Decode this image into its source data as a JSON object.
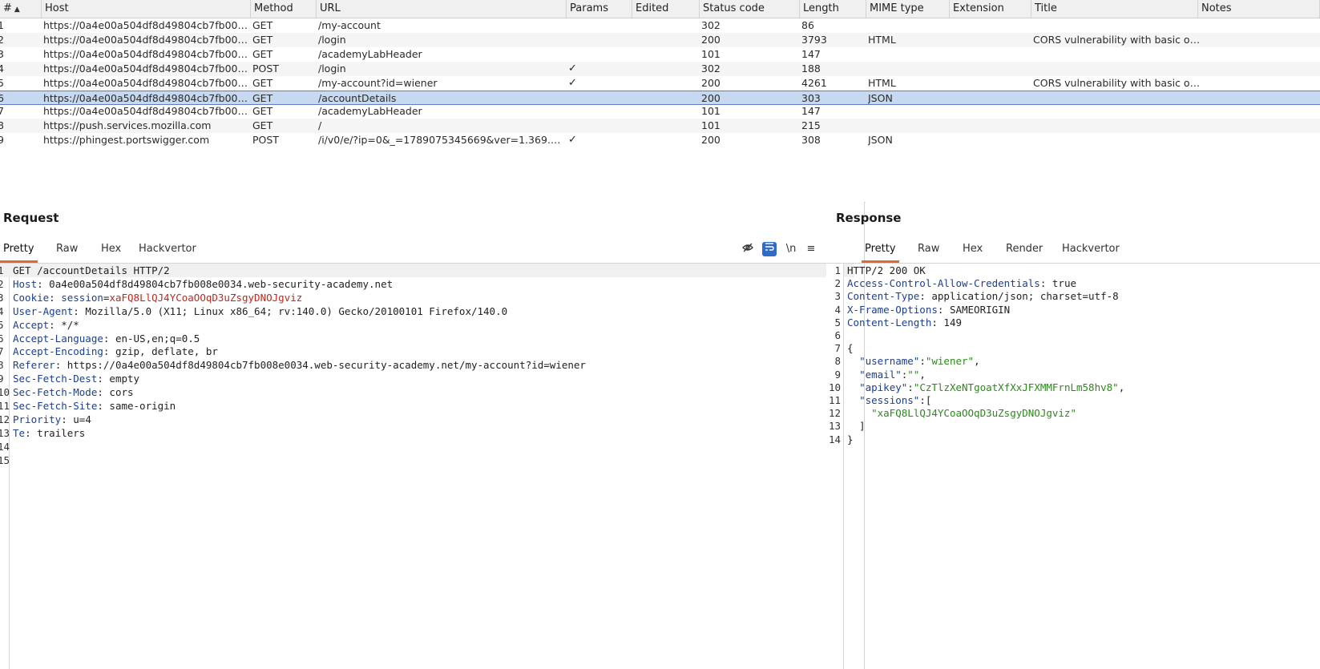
{
  "history": {
    "columns": [
      "#",
      "Host",
      "Method",
      "URL",
      "Params",
      "Edited",
      "Status code",
      "Length",
      "MIME type",
      "Extension",
      "Title",
      "Notes"
    ],
    "rows": [
      {
        "num": "1",
        "host": "https://0a4e00a504df8d49804cb7fb008e0...",
        "method": "GET",
        "url": "/my-account",
        "params": "",
        "edited": "",
        "status": "302",
        "length": "86",
        "mime": "",
        "ext": "",
        "title": ""
      },
      {
        "num": "2",
        "host": "https://0a4e00a504df8d49804cb7fb008e0...",
        "method": "GET",
        "url": "/login",
        "params": "",
        "edited": "",
        "status": "200",
        "length": "3793",
        "mime": "HTML",
        "ext": "",
        "title": "CORS vulnerability with basic origin..."
      },
      {
        "num": "3",
        "host": "https://0a4e00a504df8d49804cb7fb008e0...",
        "method": "GET",
        "url": "/academyLabHeader",
        "params": "",
        "edited": "",
        "status": "101",
        "length": "147",
        "mime": "",
        "ext": "",
        "title": ""
      },
      {
        "num": "4",
        "host": "https://0a4e00a504df8d49804cb7fb008e0...",
        "method": "POST",
        "url": "/login",
        "params": "✓",
        "edited": "",
        "status": "302",
        "length": "188",
        "mime": "",
        "ext": "",
        "title": ""
      },
      {
        "num": "5",
        "host": "https://0a4e00a504df8d49804cb7fb008e0...",
        "method": "GET",
        "url": "/my-account?id=wiener",
        "params": "✓",
        "edited": "",
        "status": "200",
        "length": "4261",
        "mime": "HTML",
        "ext": "",
        "title": "CORS vulnerability with basic origin..."
      },
      {
        "num": "6",
        "host": "https://0a4e00a504df8d49804cb7fb008e0...",
        "method": "GET",
        "url": "/accountDetails",
        "params": "",
        "edited": "",
        "status": "200",
        "length": "303",
        "mime": "JSON",
        "ext": "",
        "title": ""
      },
      {
        "num": "7",
        "host": "https://0a4e00a504df8d49804cb7fb008e0...",
        "method": "GET",
        "url": "/academyLabHeader",
        "params": "",
        "edited": "",
        "status": "101",
        "length": "147",
        "mime": "",
        "ext": "",
        "title": ""
      },
      {
        "num": "8",
        "host": "https://push.services.mozilla.com",
        "method": "GET",
        "url": "/",
        "params": "",
        "edited": "",
        "status": "101",
        "length": "215",
        "mime": "",
        "ext": "",
        "title": ""
      },
      {
        "num": "9",
        "host": "https://phingest.portswigger.com",
        "method": "POST",
        "url": "/i/v0/e/?ip=0&_=1789075345669&ver=1.369.0&comp...",
        "params": "✓",
        "edited": "",
        "status": "200",
        "length": "308",
        "mime": "JSON",
        "ext": "",
        "title": ""
      }
    ],
    "selected_row": 5,
    "sort_icon": "sort-asc-icon"
  },
  "request": {
    "title": "Request",
    "tabs": [
      "Pretty",
      "Raw",
      "Hex",
      "Hackvertor"
    ],
    "active_tab": "Pretty",
    "tool_icons": [
      "eye-off-icon",
      "word-wrap-icon",
      "newline-icon",
      "menu-icon"
    ],
    "newline_label": "\\n",
    "lines": [
      {
        "n": "1",
        "k": "",
        "v": "GET /accountDetails HTTP/2"
      },
      {
        "n": "2",
        "k": "Host",
        "v": "0a4e00a504df8d49804cb7fb008e0034.web-security-academy.net"
      },
      {
        "n": "3",
        "k": "Cookie",
        "v": "session=xaFQ8LlQJ4YCoaOOqD3uZsgyDNOJgviz"
      },
      {
        "n": "4",
        "k": "User-Agent",
        "v": "Mozilla/5.0 (X11; Linux x86_64; rv:140.0) Gecko/20100101 Firefox/140.0"
      },
      {
        "n": "5",
        "k": "Accept",
        "v": "*/*"
      },
      {
        "n": "6",
        "k": "Accept-Language",
        "v": "en-US,en;q=0.5"
      },
      {
        "n": "7",
        "k": "Accept-Encoding",
        "v": "gzip, deflate, br"
      },
      {
        "n": "8",
        "k": "Referer",
        "v": "https://0a4e00a504df8d49804cb7fb008e0034.web-security-academy.net/my-account?id=wiener"
      },
      {
        "n": "9",
        "k": "Sec-Fetch-Dest",
        "v": "empty"
      },
      {
        "n": "10",
        "k": "Sec-Fetch-Mode",
        "v": "cors"
      },
      {
        "n": "11",
        "k": "Sec-Fetch-Site",
        "v": "same-origin"
      },
      {
        "n": "12",
        "k": "Priority",
        "v": "u=4"
      },
      {
        "n": "13",
        "k": "Te",
        "v": "trailers"
      },
      {
        "n": "14",
        "k": "",
        "v": ""
      },
      {
        "n": "15",
        "k": "",
        "v": ""
      }
    ],
    "cookie_name": "session",
    "cookie_value": "xaFQ8LlQJ4YCoaOOqD3uZsgyDNOJgviz"
  },
  "response": {
    "title": "Response",
    "tabs": [
      "Pretty",
      "Raw",
      "Hex",
      "Render",
      "Hackvertor"
    ],
    "active_tab": "Pretty",
    "lines": [
      {
        "n": "1",
        "t": "status",
        "v": "HTTP/2 200 OK"
      },
      {
        "n": "2",
        "t": "header",
        "k": "Access-Control-Allow-Credentials",
        "v": "true"
      },
      {
        "n": "3",
        "t": "header",
        "k": "Content-Type",
        "v": "application/json; charset=utf-8"
      },
      {
        "n": "4",
        "t": "header",
        "k": "X-Frame-Options",
        "v": "SAMEORIGIN"
      },
      {
        "n": "5",
        "t": "header",
        "k": "Content-Length",
        "v": "149"
      },
      {
        "n": "6",
        "t": "blank",
        "v": ""
      },
      {
        "n": "7",
        "t": "plain",
        "v": "{"
      },
      {
        "n": "8",
        "t": "kv",
        "indent": "  ",
        "k": "\"username\"",
        "v": "\"wiener\"",
        "tail": ","
      },
      {
        "n": "9",
        "t": "kv",
        "indent": "  ",
        "k": "\"email\"",
        "v": "\"\"",
        "tail": ","
      },
      {
        "n": "10",
        "t": "kv",
        "indent": "  ",
        "k": "\"apikey\"",
        "v": "\"CzTlzXeNTgoatXfXxJFXMMFrnLm58hv8\"",
        "tail": ","
      },
      {
        "n": "11",
        "t": "kv",
        "indent": "  ",
        "k": "\"sessions\"",
        "v": "",
        "tail": "["
      },
      {
        "n": "12",
        "t": "str",
        "indent": "    ",
        "v": "\"xaFQ8LlQJ4YCoaOOqD3uZsgyDNOJgviz\""
      },
      {
        "n": "13",
        "t": "plain",
        "v": "  ]"
      },
      {
        "n": "14",
        "t": "plain",
        "v": "}"
      }
    ]
  },
  "colors": {
    "accent": "#e8652c",
    "selection": "#c6d9f0",
    "header_key": "#1d3f8f",
    "cookie_value": "#c0271e",
    "json_string": "#2b8a1a"
  }
}
